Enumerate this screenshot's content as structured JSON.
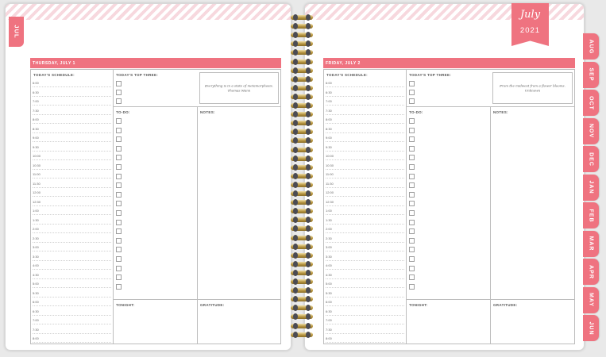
{
  "left_tab": {
    "label": "JUL"
  },
  "banner": {
    "month": "July",
    "year": "2021"
  },
  "month_tabs": [
    "AUG",
    "SEP",
    "OCT",
    "NOV",
    "DEC",
    "JAN",
    "FEB",
    "MAR",
    "APR",
    "MAY",
    "JUN"
  ],
  "labels": {
    "schedule": "TODAY'S SCHEDULE:",
    "top_three": "TODAY'S TOP THREE:",
    "todo": "TO-DO:",
    "notes": "NOTES:",
    "tonight": "TONIGHT:",
    "gratitude": "GRATITUDE:"
  },
  "times": [
    "6:00",
    "6:30",
    "7:00",
    "7:30",
    "8:00",
    "8:30",
    "9:00",
    "9:30",
    "10:00",
    "10:30",
    "11:00",
    "11:30",
    "12:00",
    "12:30",
    "1:00",
    "1:30",
    "2:00",
    "2:30",
    "3:00",
    "3:30",
    "4:00",
    "4:30",
    "5:00",
    "5:30",
    "6:00",
    "6:30",
    "7:00",
    "7:30",
    "8:00"
  ],
  "days": [
    {
      "header": "THURSDAY, JULY 1",
      "quote": "Everything is in a state of metamorphosis.",
      "author": "Thomas Mann"
    },
    {
      "header": "FRIDAY, JULY 2",
      "quote": "From the midwest from a flower blooms.",
      "author": "Unknown"
    }
  ],
  "colors": {
    "accent": "#ef7380",
    "stripe": "#f7d8de",
    "spiral": "#c9a85a"
  }
}
